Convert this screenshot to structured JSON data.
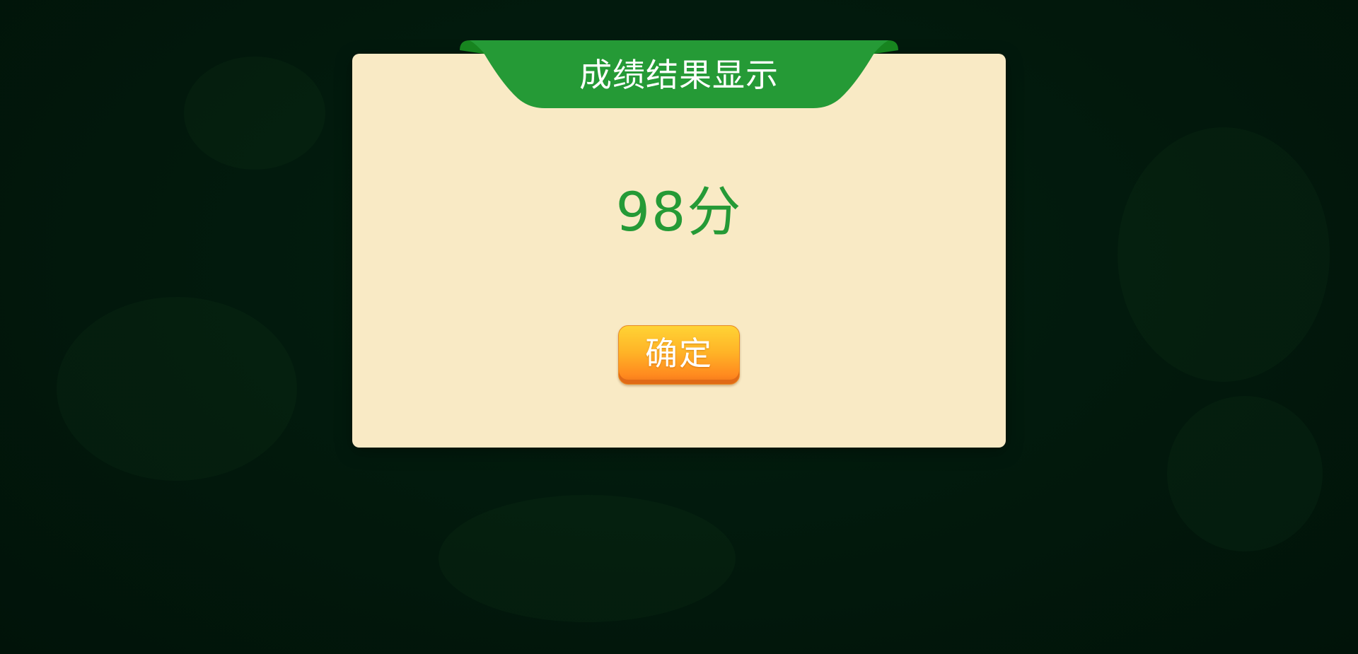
{
  "dialog": {
    "title": "成绩结果显示",
    "score": "98分",
    "confirm_label": "确定"
  },
  "colors": {
    "background": "#021a0d",
    "panel": "#f9eac5",
    "ribbon": "#259a36",
    "ribbon_dark": "#17841f",
    "score_text": "#259a36",
    "button_top": "#ffd335",
    "button_bottom": "#ff8a1f"
  }
}
